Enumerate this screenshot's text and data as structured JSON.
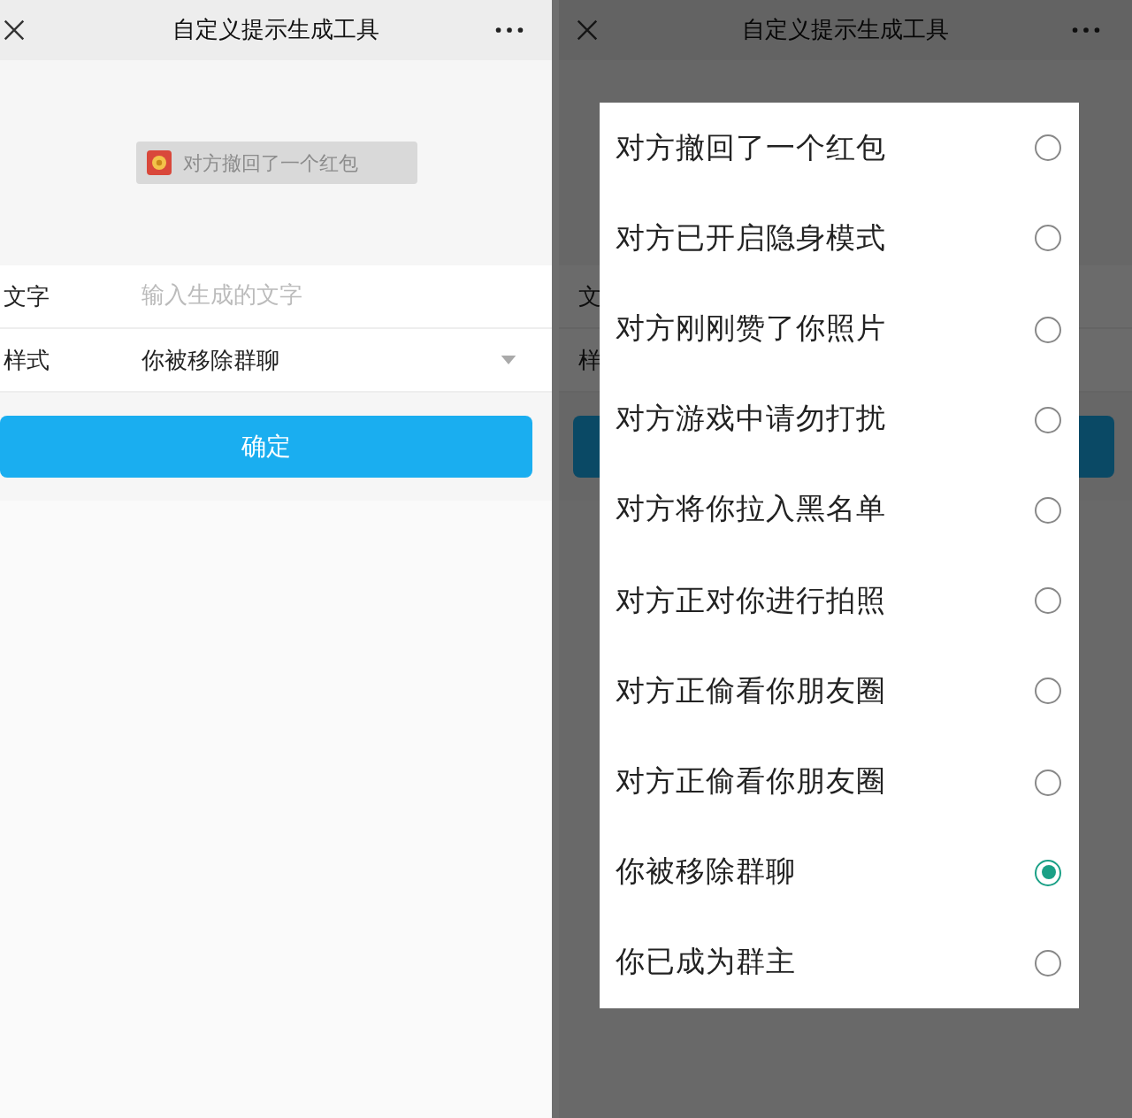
{
  "left_screen": {
    "title": "自定义提示生成工具",
    "preview": {
      "text": "对方撤回了一个红包"
    },
    "fields": [
      {
        "kind": "input",
        "label": "文字",
        "placeholder": "输入生成的文字"
      },
      {
        "kind": "select",
        "label": "样式",
        "value": "你被移除群聊"
      }
    ],
    "confirm": "确定"
  },
  "right_screen": {
    "title": "自定义提示生成工具",
    "field_labels": [
      "文",
      "样"
    ],
    "options": [
      {
        "label": "对方撤回了一个红包",
        "selected": false
      },
      {
        "label": "对方已开启隐身模式",
        "selected": false
      },
      {
        "label": "对方刚刚赞了你照片",
        "selected": false
      },
      {
        "label": "对方游戏中请勿打扰",
        "selected": false
      },
      {
        "label": "对方将你拉入黑名单",
        "selected": false
      },
      {
        "label": "对方正对你进行拍照",
        "selected": false
      },
      {
        "label": "对方正偷看你朋友圈",
        "selected": false
      },
      {
        "label": "对方正偷看你朋友圈",
        "selected": false
      },
      {
        "label": "你被移除群聊",
        "selected": true
      },
      {
        "label": "你已成为群主",
        "selected": false
      }
    ]
  }
}
